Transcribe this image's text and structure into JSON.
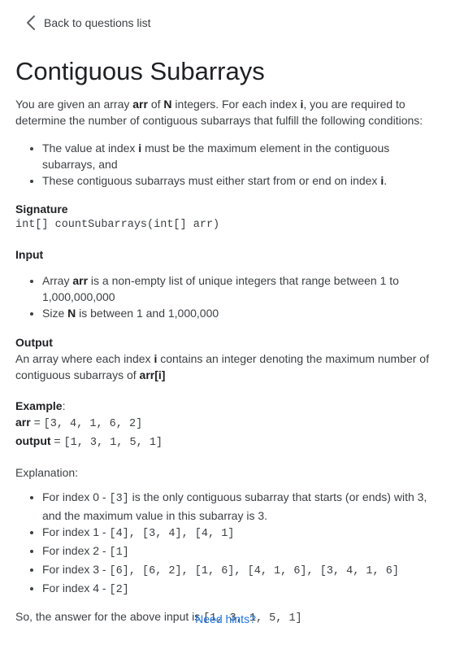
{
  "nav": {
    "back_label": "Back to questions list"
  },
  "title": "Contiguous Subarrays",
  "intro": {
    "t1": "You are given an array ",
    "b1": "arr",
    "t2": " of ",
    "b2": "N",
    "t3": " integers. For each index ",
    "b3": "i",
    "t4": ", you are required to determine the number of contiguous subarrays that fulfill the following conditions:"
  },
  "conditions": {
    "c1": {
      "t1": "The value at index ",
      "b1": "i",
      "t2": " must be the maximum element in the contiguous subarrays, and"
    },
    "c2": {
      "t1": "These contiguous subarrays must either start from or end on index ",
      "b1": "i",
      "t2": "."
    }
  },
  "signature": {
    "heading": "Signature",
    "code": "int[] countSubarrays(int[] arr)"
  },
  "input": {
    "heading": "Input",
    "i1": {
      "t1": "Array ",
      "b1": "arr",
      "t2": " is a non-empty list of unique integers that range between 1 to 1,000,000,000"
    },
    "i2": {
      "t1": "Size ",
      "b1": "N",
      "t2": " is between 1 and 1,000,000"
    }
  },
  "output": {
    "heading": "Output",
    "t1": "An array where each index ",
    "b1": "i",
    "t2": " contains an integer denoting the maximum number of contiguous subarrays of ",
    "b2": "arr[i]"
  },
  "example": {
    "heading": "Example",
    "colon": ":",
    "arr_label": "arr",
    "eq": " = ",
    "arr_code": "[3, 4, 1, 6, 2]",
    "output_label": "output",
    "output_code": "[1, 3, 1, 5, 1]"
  },
  "explanation": {
    "heading": "Explanation:",
    "e0": {
      "t1": "For index 0 - ",
      "code": "[3]",
      "t2": " is the only contiguous subarray that starts (or ends) with 3, and the maximum value in this subarray is 3."
    },
    "e1": {
      "t1": "For index 1 - ",
      "code": "[4], [3, 4], [4, 1]"
    },
    "e2": {
      "t1": "For index 2 - ",
      "code": "[1]"
    },
    "e3": {
      "t1": "For index 3 - ",
      "code": "[6], [6, 2], [1, 6], [4, 1, 6], [3, 4, 1, 6]"
    },
    "e4": {
      "t1": "For index 4 - ",
      "code": "[2]"
    }
  },
  "answer": {
    "t1": "So, the answer for the above input is ",
    "code": "[1, 3, 1, 5, 1]"
  },
  "hints_label": "Need hints?",
  "colors": {
    "link": "#1a73e8",
    "text": "#3c4043",
    "heading": "#202124"
  }
}
